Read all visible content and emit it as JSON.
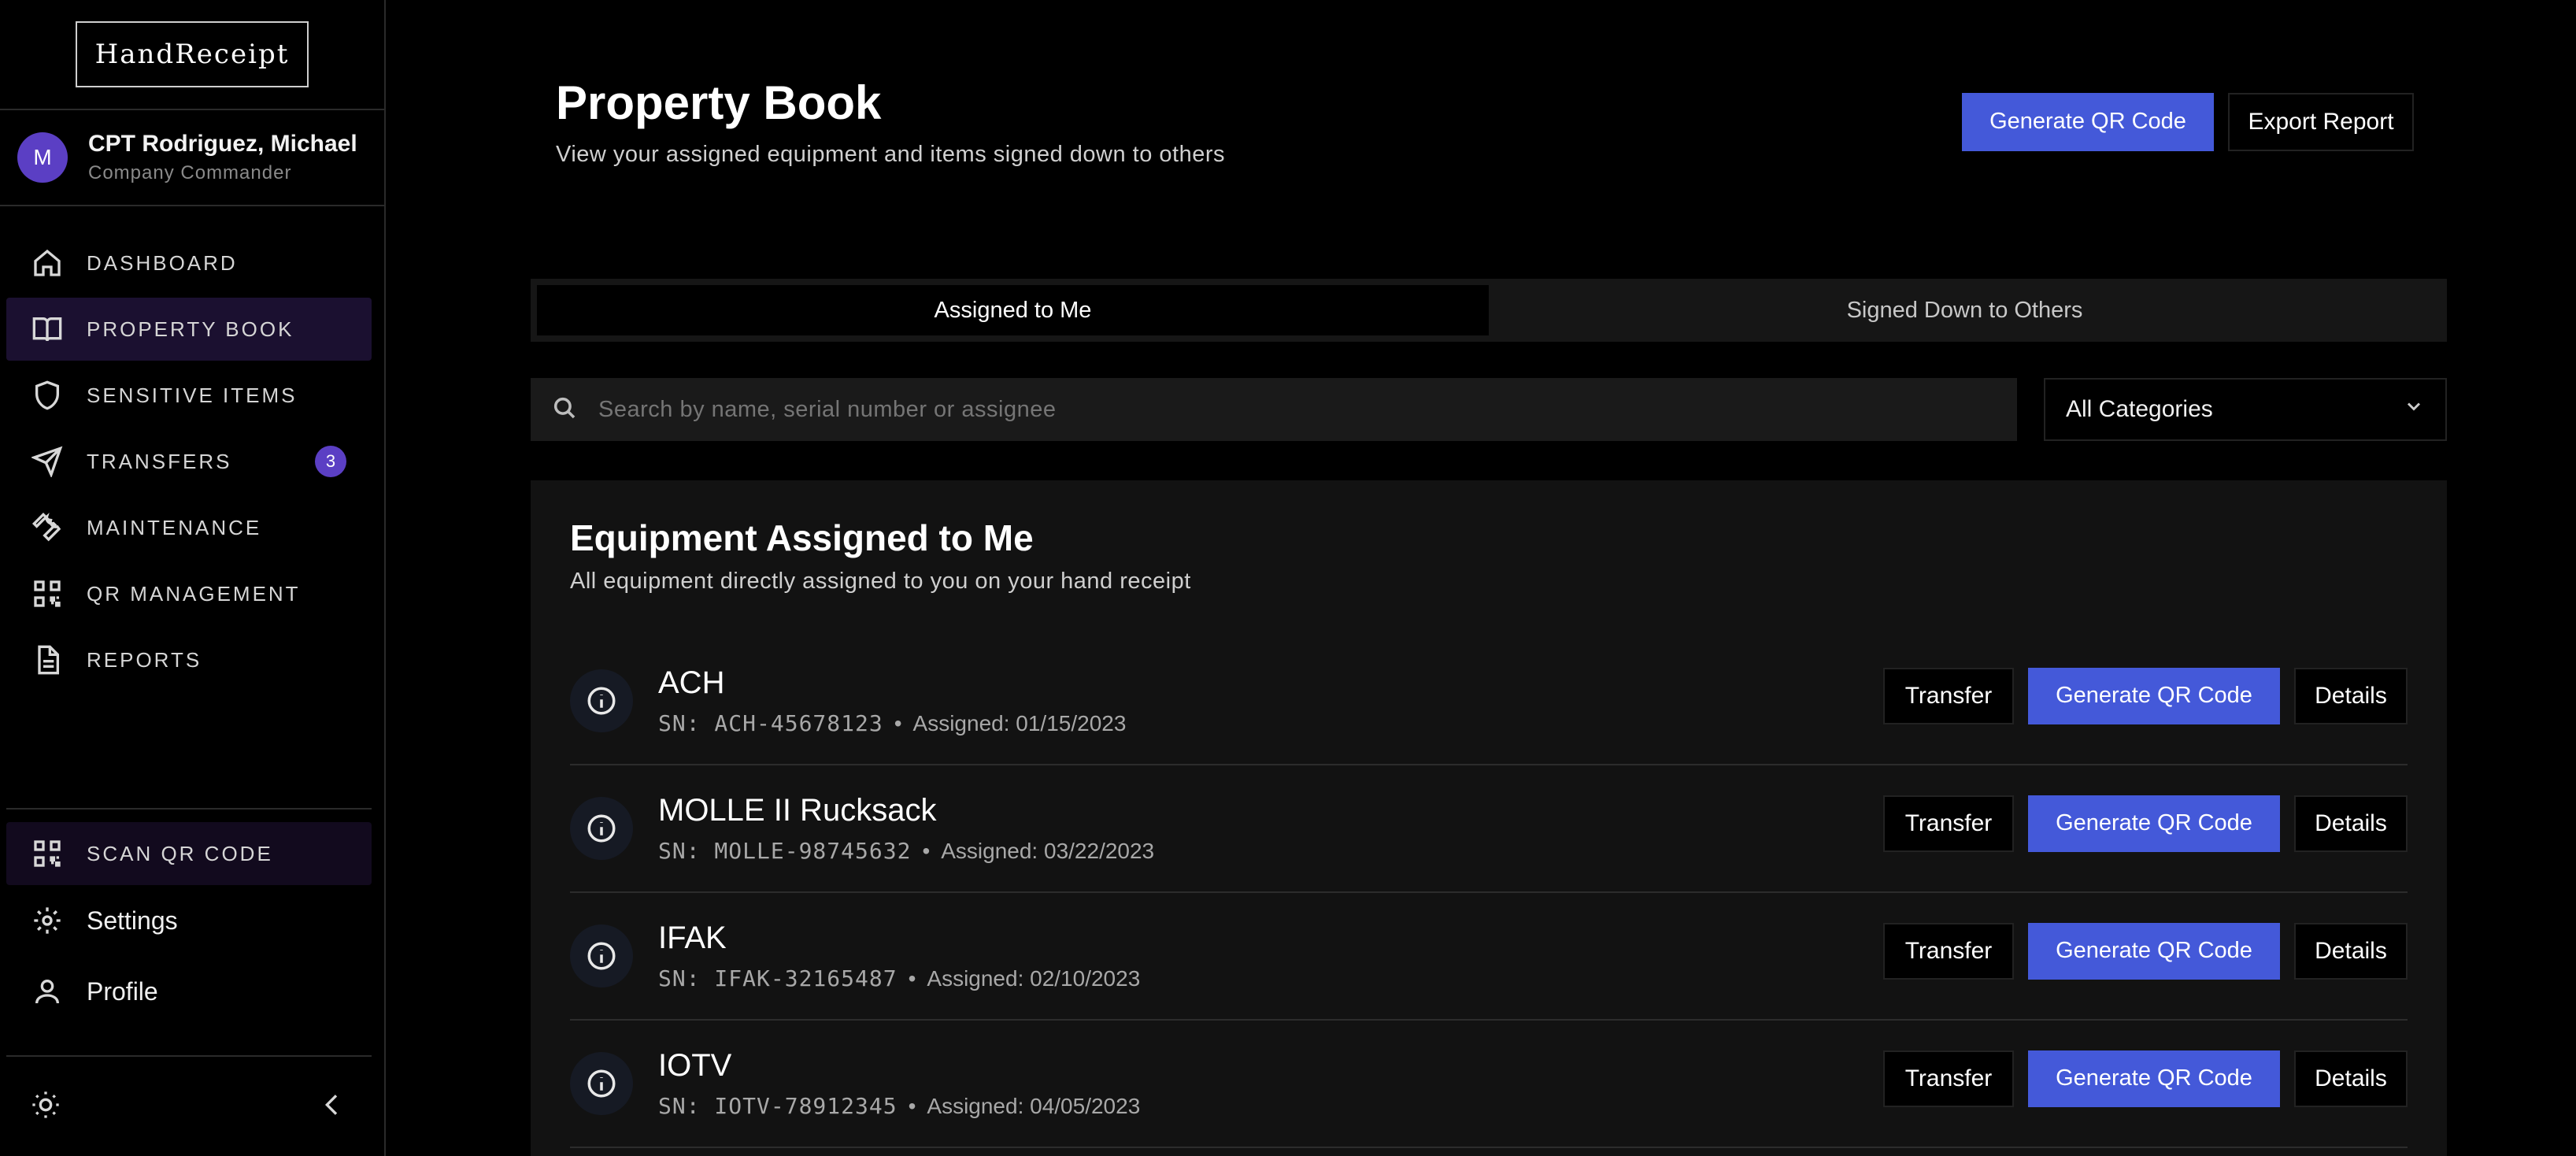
{
  "app": {
    "logo": "HandReceipt"
  },
  "user": {
    "initial": "M",
    "name": "CPT Rodriguez, Michael",
    "role": "Company Commander"
  },
  "nav": {
    "items": [
      {
        "label": "DASHBOARD",
        "icon": "home-icon"
      },
      {
        "label": "PROPERTY BOOK",
        "icon": "book-icon",
        "active": true
      },
      {
        "label": "SENSITIVE ITEMS",
        "icon": "shield-icon"
      },
      {
        "label": "TRANSFERS",
        "icon": "send-icon",
        "badge": "3"
      },
      {
        "label": "MAINTENANCE",
        "icon": "wrench-icon"
      },
      {
        "label": "QR MANAGEMENT",
        "icon": "qr-icon"
      },
      {
        "label": "REPORTS",
        "icon": "document-icon"
      }
    ],
    "scan_label": "SCAN QR CODE",
    "settings_label": "Settings",
    "profile_label": "Profile"
  },
  "header": {
    "title": "Property Book",
    "subtitle": "View your assigned equipment and items signed down to others",
    "generate_qr": "Generate QR Code",
    "export": "Export Report"
  },
  "tabs": [
    {
      "label": "Assigned to Me",
      "active": true
    },
    {
      "label": "Signed Down to Others"
    }
  ],
  "search": {
    "placeholder": "Search by name, serial number or assignee"
  },
  "filter": {
    "selected": "All Categories"
  },
  "section": {
    "title": "Equipment Assigned to Me",
    "subtitle": "All equipment directly assigned to you on your hand receipt"
  },
  "row_actions": {
    "transfer": "Transfer",
    "generate_qr": "Generate QR Code",
    "details": "Details"
  },
  "items": [
    {
      "name": "ACH",
      "sn": "SN: ACH-45678123",
      "assigned": "Assigned: 01/15/2023"
    },
    {
      "name": "MOLLE II Rucksack",
      "sn": "SN: MOLLE-98745632",
      "assigned": "Assigned: 03/22/2023"
    },
    {
      "name": "IFAK",
      "sn": "SN: IFAK-32165487",
      "assigned": "Assigned: 02/10/2023"
    },
    {
      "name": "IOTV",
      "sn": "SN: IOTV-78912345",
      "assigned": "Assigned: 04/05/2023"
    }
  ],
  "colors": {
    "accent": "#4459d9",
    "brand_purple": "#5b3fc4",
    "active_nav_bg": "#1b1030"
  }
}
